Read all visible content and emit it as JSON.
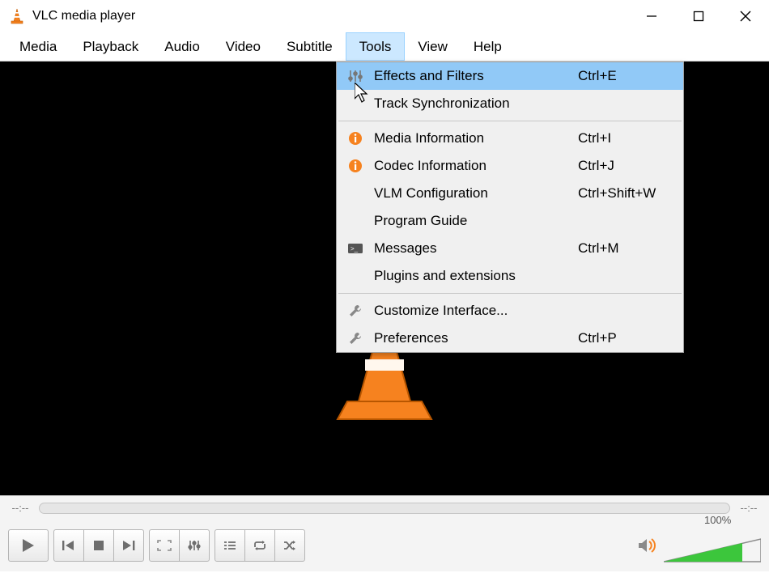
{
  "title": "VLC media player",
  "menubar": [
    "Media",
    "Playback",
    "Audio",
    "Video",
    "Subtitle",
    "Tools",
    "View",
    "Help"
  ],
  "active_menu_index": 5,
  "tools_menu": [
    {
      "icon": "sliders",
      "label": "Effects and Filters",
      "shortcut": "Ctrl+E",
      "highlight": true
    },
    {
      "icon": "",
      "label": "Track Synchronization",
      "shortcut": ""
    },
    {
      "sep": true
    },
    {
      "icon": "info",
      "label": "Media Information",
      "shortcut": "Ctrl+I"
    },
    {
      "icon": "info",
      "label": "Codec Information",
      "shortcut": "Ctrl+J"
    },
    {
      "icon": "",
      "label": "VLM Configuration",
      "shortcut": "Ctrl+Shift+W"
    },
    {
      "icon": "",
      "label": "Program Guide",
      "shortcut": ""
    },
    {
      "icon": "console",
      "label": "Messages",
      "shortcut": "Ctrl+M"
    },
    {
      "icon": "",
      "label": "Plugins and extensions",
      "shortcut": ""
    },
    {
      "sep": true
    },
    {
      "icon": "wrench",
      "label": "Customize Interface...",
      "shortcut": ""
    },
    {
      "icon": "wrench",
      "label": "Preferences",
      "shortcut": "Ctrl+P"
    }
  ],
  "time_elapsed": "--:--",
  "time_total": "--:--",
  "volume_label": "100%"
}
